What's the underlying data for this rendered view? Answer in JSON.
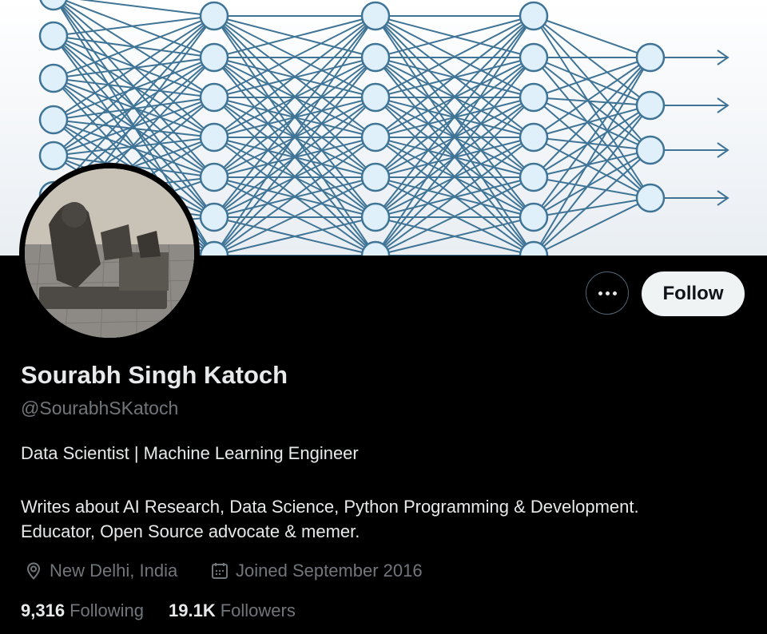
{
  "profile": {
    "name": "Sourabh Singh Katoch",
    "handle": "@SourabhSKatoch",
    "bio_line1": "Data Scientist | Machine Learning Engineer",
    "bio_line2": "Writes about AI Research, Data Science, Python Programming & Development.",
    "bio_line3": "Educator, Open Source advocate & memer.",
    "location": "New Delhi, India",
    "joined": "Joined September 2016"
  },
  "actions": {
    "follow_label": "Follow",
    "more_icon": "more-options-icon"
  },
  "stats": {
    "following_count": "9,316",
    "following_label": "Following",
    "followers_count": "19.1K",
    "followers_label": "Followers"
  },
  "banner": {
    "description_icon": "neural-network-banner",
    "line_color": "#3f7496",
    "node_fill": "#dff0fa"
  },
  "colors": {
    "background": "#000000",
    "primary_text": "#e7e9ea",
    "secondary_text": "#71767b",
    "follow_bg": "#eff3f4"
  }
}
